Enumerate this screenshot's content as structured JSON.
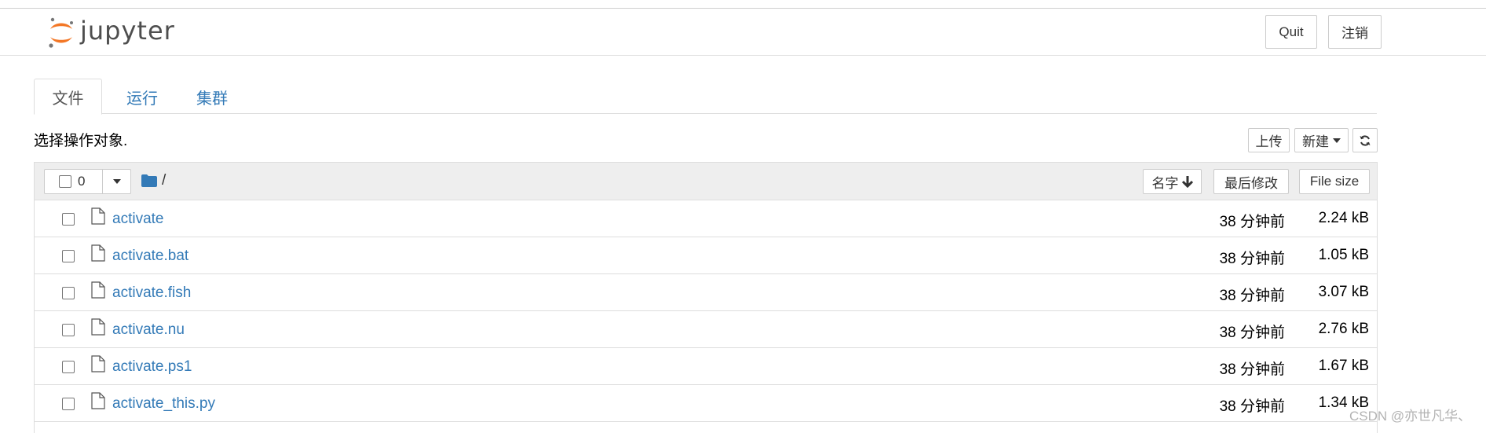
{
  "header": {
    "logo_text": "jupyter",
    "quit_label": "Quit",
    "logout_label": "注销"
  },
  "tabs": [
    {
      "label": "文件",
      "active": true
    },
    {
      "label": "运行",
      "active": false
    },
    {
      "label": "集群",
      "active": false
    }
  ],
  "toolbar": {
    "hint": "选择操作对象.",
    "upload_label": "上传",
    "new_label": "新建",
    "refresh_icon": "refresh-icon"
  },
  "list_header": {
    "selected_count": "0",
    "breadcrumb": "/",
    "sort_name_label": "名字",
    "sort_modified_label": "最后修改",
    "sort_size_label": "File size"
  },
  "files": [
    {
      "name": "activate",
      "modified": "38 分钟前",
      "size": "2.24 kB"
    },
    {
      "name": "activate.bat",
      "modified": "38 分钟前",
      "size": "1.05 kB"
    },
    {
      "name": "activate.fish",
      "modified": "38 分钟前",
      "size": "3.07 kB"
    },
    {
      "name": "activate.nu",
      "modified": "38 分钟前",
      "size": "2.76 kB"
    },
    {
      "name": "activate.ps1",
      "modified": "38 分钟前",
      "size": "1.67 kB"
    },
    {
      "name": "activate_this.py",
      "modified": "38 分钟前",
      "size": "1.34 kB"
    }
  ],
  "watermark": "CSDN @亦世凡华、",
  "colors": {
    "link": "#337ab7",
    "logo_orange": "#f37726",
    "logo_gray": "#767677"
  }
}
